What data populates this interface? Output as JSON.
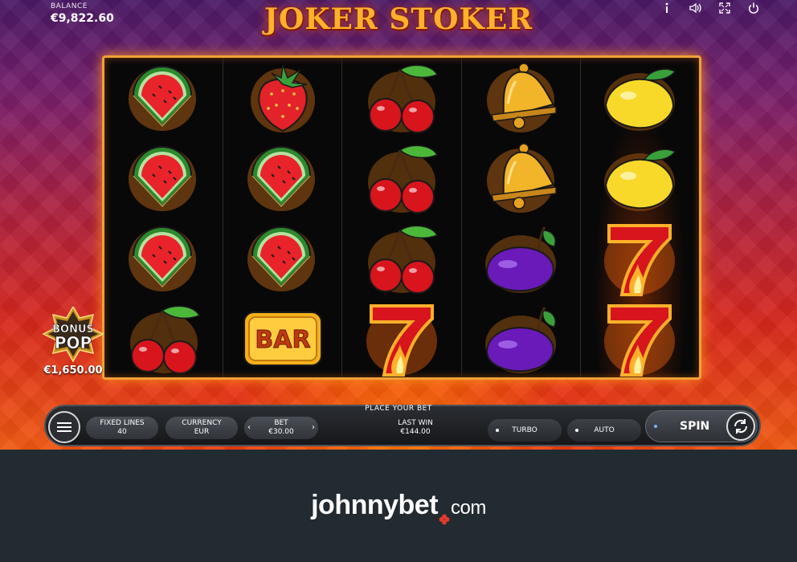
{
  "game": {
    "title": "JOKER STOKER",
    "balance_label": "BALANCE",
    "balance_value": "€9,822.60"
  },
  "top_icons": [
    "info-icon",
    "sound-icon",
    "fullscreen-icon",
    "power-icon"
  ],
  "reels": [
    [
      "watermelon",
      "watermelon",
      "watermelon",
      "cherry"
    ],
    [
      "strawberry",
      "watermelon",
      "watermelon",
      "bar"
    ],
    [
      "cherry",
      "cherry",
      "cherry",
      "seven"
    ],
    [
      "bell",
      "bell",
      "plum",
      "plum"
    ],
    [
      "lemon",
      "lemon",
      "seven",
      "seven"
    ]
  ],
  "bar_symbol_text": "BAR",
  "bonus": {
    "line1": "BONUS",
    "line2": "POP",
    "value": "€1,650.00"
  },
  "controls": {
    "place_bet": "PLACE YOUR BET",
    "fixed_lines_label": "FIXED LINES",
    "fixed_lines_value": "40",
    "currency_label": "CURRENCY",
    "currency_value": "EUR",
    "bet_label": "BET",
    "bet_value": "€30.00",
    "last_win_label": "LAST WIN",
    "last_win_value": "€144.00",
    "turbo_label": "TURBO",
    "auto_label": "AUTO",
    "spin_label": "SPIN"
  },
  "footer": {
    "brand": "johnnybet",
    "domain": "com"
  },
  "colors": {
    "frame": "#f0a038",
    "logo": "#ffb12a",
    "footer_bg": "#222a32"
  }
}
